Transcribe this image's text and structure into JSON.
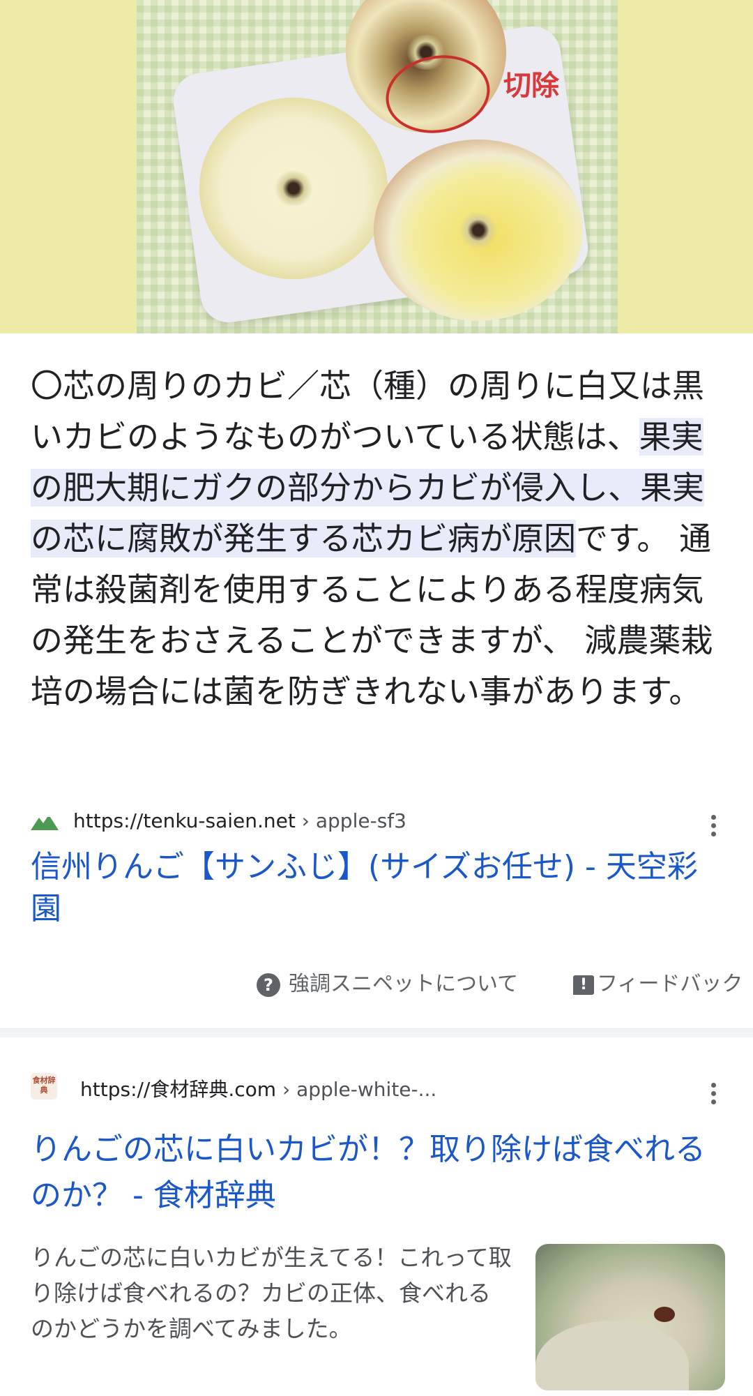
{
  "hero": {
    "annotation_label": "切除",
    "annotation_color": "#d73a3a"
  },
  "snippet": {
    "before": "〇芯の周りのカビ／芯（種）の周りに白又は黒いカビのようなものがついている状態は、",
    "highlight": "果実の肥大期にガクの部分からカビが侵入し、果実の芯に腐敗が発生する芯カビ病が原因",
    "after": "です。 通常は殺菌剤を使用することによりある程度病気の発生をおさえることができますが、 減農薬栽培の場合には菌を防ぎきれない事があります。"
  },
  "result1": {
    "favicon": "mountain-icon",
    "url_domain": "https://tenku-saien.net",
    "url_path": " › apple-sf3",
    "title": "信州りんご【サンふじ】(サイズお任せ) - 天空彩園"
  },
  "snippet_footer": {
    "about_label": "強調スニペットについて",
    "feedback_label": "フィードバック"
  },
  "result2": {
    "favicon_text": "食材辞典",
    "url_domain": "https://食材辞典.com",
    "url_path": " › apple-white-...",
    "title": "りんごの芯に白いカビが！？取り除けば食べれるのか？ - 食材辞典",
    "description": "りんごの芯に白いカビが生えてる！これって取り除けば食べれるの？カビの正体、食べれるのかどうかを調べてみました。"
  },
  "colors": {
    "link": "#1a57c8",
    "highlight_bg": "#e8ebfa",
    "hero_bg": "#eeeaa8"
  }
}
